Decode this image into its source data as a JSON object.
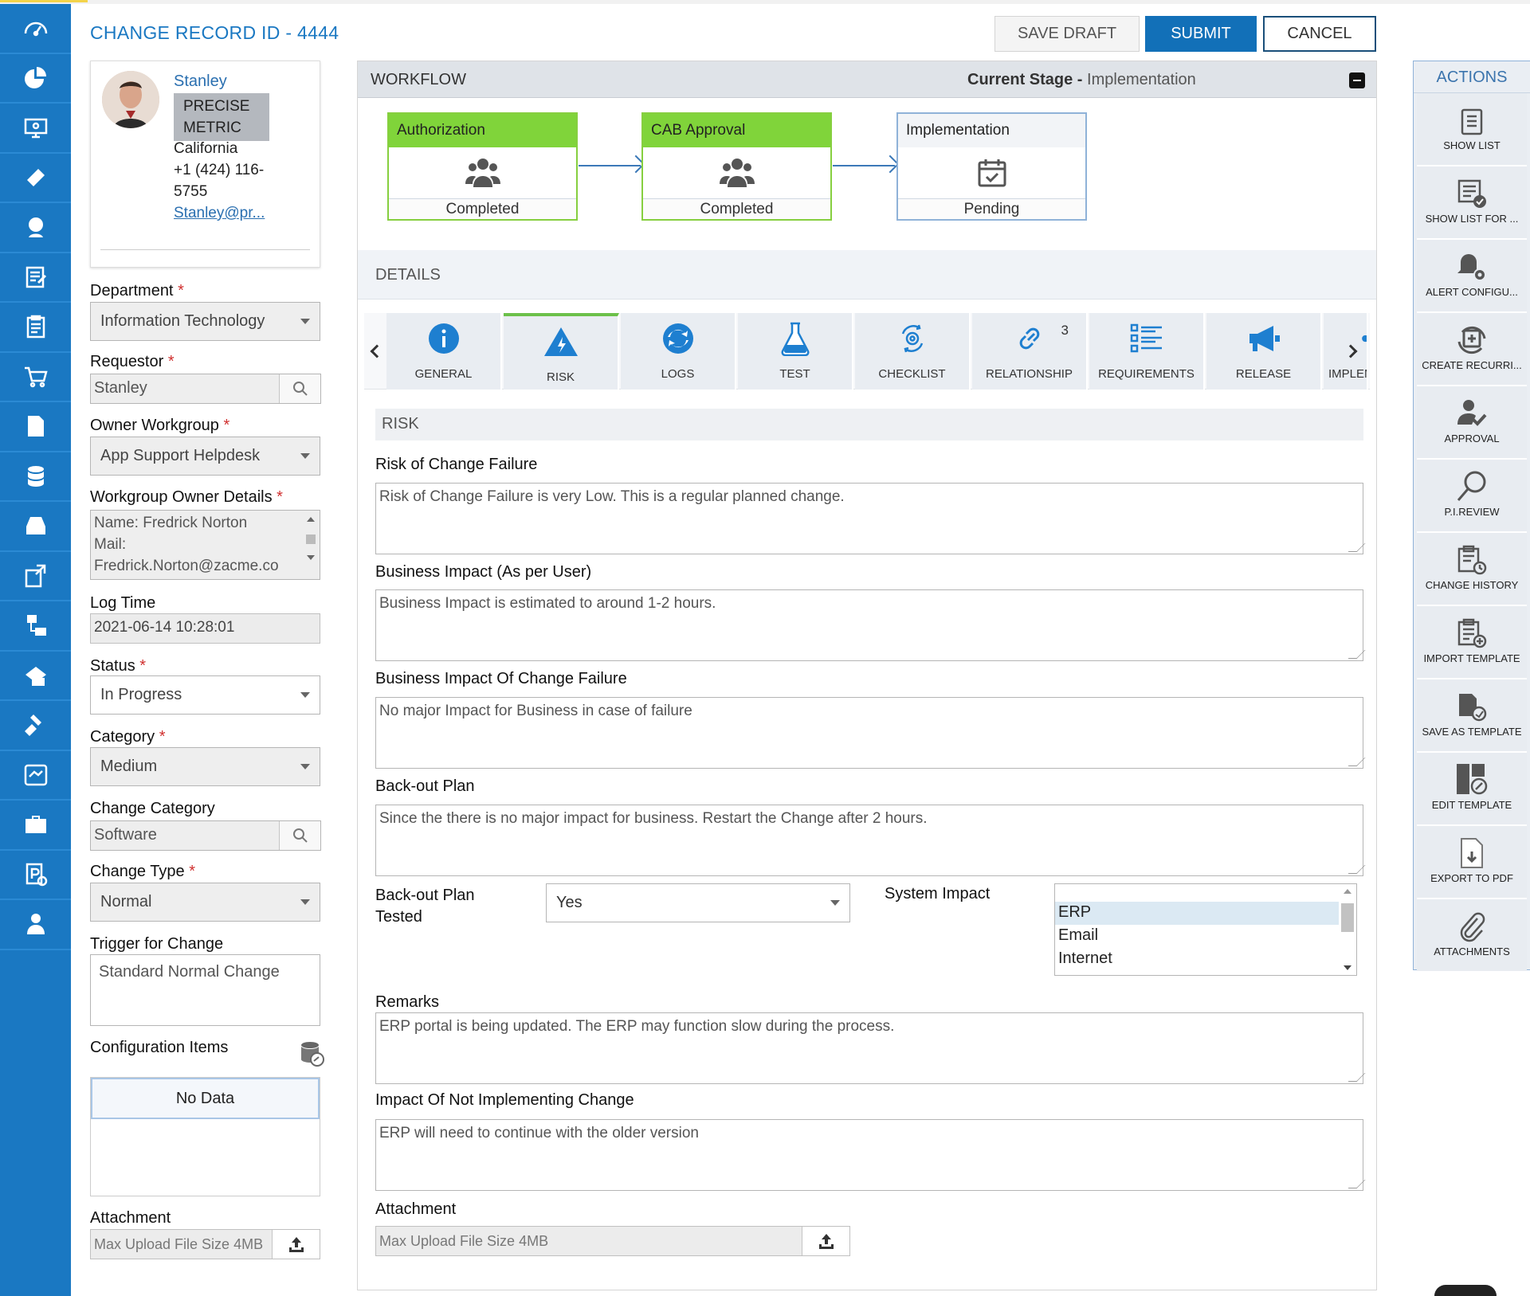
{
  "header": {
    "title": "CHANGE RECORD ID -  4444",
    "save_draft": "SAVE DRAFT",
    "submit": "SUBMIT",
    "cancel": "CANCEL"
  },
  "profile": {
    "name": "Stanley",
    "company_line1": "PRECISE",
    "company_line2": "METRIC",
    "location": "California",
    "phone_line1": "+1 (424) 116-",
    "phone_line2": "5755",
    "email": "Stanley@pr..."
  },
  "form": {
    "department": {
      "label": "Department",
      "value": "Information Technology"
    },
    "requestor": {
      "label": "Requestor",
      "value": "Stanley"
    },
    "owner_workgroup": {
      "label": "Owner Workgroup",
      "value": "App Support Helpdesk"
    },
    "workgroup_owner_details": {
      "label": "Workgroup Owner Details",
      "line1": "Name: Fredrick Norton",
      "line2": "Mail:",
      "line3": "Fredrick.Norton@zacme.co"
    },
    "log_time": {
      "label": "Log Time",
      "value": "2021-06-14 10:28:01"
    },
    "status": {
      "label": "Status",
      "value": "In Progress"
    },
    "category": {
      "label": "Category",
      "value": "Medium"
    },
    "change_category": {
      "label": "Change Category",
      "value": "Software"
    },
    "change_type": {
      "label": "Change Type",
      "value": "Normal"
    },
    "trigger": {
      "label": "Trigger for Change",
      "value": "Standard Normal Change"
    },
    "config_items": {
      "label": "Configuration Items",
      "empty": "No Data"
    },
    "attachment": {
      "label": "Attachment",
      "placeholder": "Max Upload File Size 4MB"
    },
    "required_mark": "*"
  },
  "workflow": {
    "title": "WORKFLOW",
    "current_stage_label": "Current Stage -",
    "current_stage": "Implementation",
    "stages": [
      {
        "name": "Authorization",
        "status": "Completed"
      },
      {
        "name": "CAB Approval",
        "status": "Completed"
      },
      {
        "name": "Implementation",
        "status": "Pending"
      }
    ]
  },
  "details": {
    "title": "DETAILS",
    "tabs": [
      {
        "label": "GENERAL"
      },
      {
        "label": "RISK"
      },
      {
        "label": "LOGS"
      },
      {
        "label": "TEST"
      },
      {
        "label": "CHECKLIST"
      },
      {
        "label": "RELATIONSHIP",
        "count": "3"
      },
      {
        "label": "REQUIREMENTS"
      },
      {
        "label": "RELEASE"
      },
      {
        "label": "IMPLEMENTA"
      }
    ]
  },
  "risk": {
    "title": "RISK",
    "risk_of_change_failure": {
      "label": "Risk of Change Failure",
      "value": "Risk of Change Failure is very Low. This is a regular planned change."
    },
    "business_impact_user": {
      "label": "Business Impact (As per User)",
      "value": "Business Impact is estimated to around 1-2 hours."
    },
    "business_impact_failure": {
      "label": "Business Impact Of Change Failure",
      "value": "No major Impact for Business in case of failure"
    },
    "backout_plan": {
      "label": "Back-out Plan",
      "value": "Since the there is no major impact for business. Restart the Change after 2 hours."
    },
    "backout_tested": {
      "label_line1": "Back-out Plan",
      "label_line2": "Tested",
      "value": "Yes"
    },
    "system_impact": {
      "label": "System Impact",
      "options": [
        "ERP",
        "Email",
        "Internet"
      ]
    },
    "remarks": {
      "label": "Remarks",
      "value": "ERP portal is being updated. The ERP may function slow during the process."
    },
    "impact_not_implementing": {
      "label": "Impact Of Not Implementing Change",
      "value": "ERP will need to continue with the older version"
    },
    "attachment": {
      "label": "Attachment",
      "placeholder": "Max Upload File Size 4MB"
    }
  },
  "actions": {
    "title": "ACTIONS",
    "items": [
      {
        "label": "SHOW LIST"
      },
      {
        "label": "SHOW LIST FOR ..."
      },
      {
        "label": "ALERT CONFIGU..."
      },
      {
        "label": "CREATE RECURRI..."
      },
      {
        "label": "APPROVAL"
      },
      {
        "label": "P.I.REVIEW"
      },
      {
        "label": "CHANGE HISTORY"
      },
      {
        "label": "IMPORT TEMPLATE"
      },
      {
        "label": "SAVE AS TEMPLATE"
      },
      {
        "label": "EDIT TEMPLATE"
      },
      {
        "label": "EXPORT TO PDF"
      },
      {
        "label": "ATTACHMENTS"
      }
    ]
  },
  "colors": {
    "nav": "#1a78c2",
    "primary": "#1270b8",
    "completed_stage": "#80d43a",
    "required": "#d0302f"
  }
}
